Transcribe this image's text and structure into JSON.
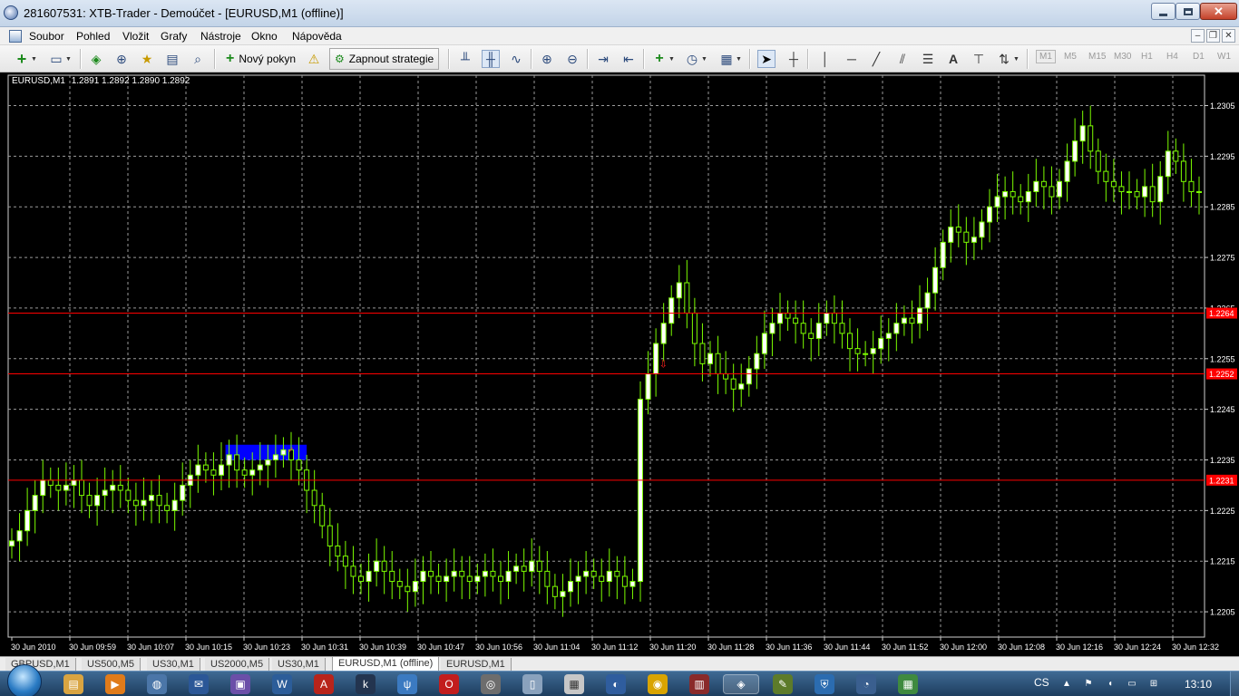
{
  "window": {
    "title": "281607531: XTB-Trader - Demoúčet - [EURUSD,M1 (offline)]",
    "close_glyph": "✕"
  },
  "menu": {
    "items": [
      "Soubor",
      "Pohled",
      "Vložit",
      "Grafy",
      "Nástroje",
      "Okno",
      "Nápověda"
    ]
  },
  "toolbar": {
    "new_order_label": "Nový pokyn",
    "strategy_label": "Zapnout strategie",
    "timeframes": [
      "M1",
      "M5",
      "M15",
      "M30",
      "H1",
      "H4",
      "D1",
      "W1"
    ],
    "active_timeframe": "M1"
  },
  "chart": {
    "info": {
      "symbol": "EURUSD,M1",
      "ohlc": "1.2891 1.2892 1.2890 1.2892"
    },
    "colors": {
      "background": "#000000",
      "grid": "#9a9a9a",
      "candle": "#7CFC00",
      "bull_body": "#ffffff",
      "hline": "#ff0000",
      "zone": "#0000ff"
    },
    "price_labels": [
      "1.2305",
      "1.2295",
      "1.2285",
      "1.2275",
      "1.2265",
      "1.2255",
      "1.2245",
      "1.2235",
      "1.2225",
      "1.2215",
      "1.2205"
    ],
    "time_labels": [
      "30 Jun 2010",
      "30 Jun 09:59",
      "30 Jun 10:07",
      "30 Jun 10:15",
      "30 Jun 10:23",
      "30 Jun 10:31",
      "30 Jun 10:39",
      "30 Jun 10:47",
      "30 Jun 10:56",
      "30 Jun 11:04",
      "30 Jun 11:12",
      "30 Jun 11:20",
      "30 Jun 11:28",
      "30 Jun 11:36",
      "30 Jun 11:44",
      "30 Jun 11:52",
      "30 Jun 12:00",
      "30 Jun 12:08",
      "30 Jun 12:16",
      "30 Jun 12:24",
      "30 Jun 12:32"
    ],
    "hlines": [
      {
        "price": 1.2264,
        "label": "1.2264"
      },
      {
        "price": 1.2252,
        "label": "1.2252"
      },
      {
        "price": 1.2231,
        "label": "1.2231"
      }
    ],
    "series": [
      1.2219,
      1.2221,
      1.2225,
      1.2228,
      1.2231,
      1.223,
      1.2229,
      1.223,
      1.2231,
      1.2228,
      1.2226,
      1.2228,
      1.2229,
      1.223,
      1.2229,
      1.2227,
      1.2226,
      1.2227,
      1.2228,
      1.2226,
      1.2225,
      1.2227,
      1.223,
      1.2232,
      1.2234,
      1.2233,
      1.2232,
      1.2234,
      1.2236,
      1.2233,
      1.2232,
      1.2233,
      1.2234,
      1.2235,
      1.2236,
      1.2237,
      1.2235,
      1.2233,
      1.2229,
      1.2226,
      1.2222,
      1.2218,
      1.2216,
      1.2214,
      1.2212,
      1.2211,
      1.2213,
      1.2215,
      1.2213,
      1.2211,
      1.221,
      1.2209,
      1.2211,
      1.2213,
      1.2212,
      1.2211,
      1.2212,
      1.2213,
      1.2212,
      1.2211,
      1.2212,
      1.2213,
      1.2212,
      1.2211,
      1.2213,
      1.2214,
      1.2213,
      1.2215,
      1.2213,
      1.221,
      1.2208,
      1.2209,
      1.2211,
      1.2212,
      1.2213,
      1.2212,
      1.2211,
      1.2213,
      1.2212,
      1.221,
      1.2211,
      1.2247,
      1.2252,
      1.2258,
      1.2262,
      1.2267,
      1.227,
      1.2264,
      1.2258,
      1.2254,
      1.2256,
      1.2252,
      1.2251,
      1.2249,
      1.225,
      1.2253,
      1.2256,
      1.226,
      1.2262,
      1.2264,
      1.2263,
      1.2262,
      1.226,
      1.2259,
      1.2262,
      1.2264,
      1.2262,
      1.226,
      1.2257,
      1.2256,
      1.2256,
      1.2257,
      1.2259,
      1.226,
      1.2262,
      1.2263,
      1.2262,
      1.2265,
      1.2268,
      1.2273,
      1.2278,
      1.2281,
      1.228,
      1.2278,
      1.2279,
      1.2282,
      1.2285,
      1.2287,
      1.2288,
      1.2287,
      1.2286,
      1.2288,
      1.229,
      1.2289,
      1.2287,
      1.229,
      1.2294,
      1.2298,
      1.2301,
      1.2296,
      1.2292,
      1.229,
      1.2289,
      1.2288,
      1.2288,
      1.2287,
      1.2289,
      1.2286,
      1.2291,
      1.2296,
      1.2294,
      1.229,
      1.2288,
      1.2288
    ],
    "buy_arrow_index": 84,
    "sell_marker_index": 36,
    "zone": {
      "from_index": 28,
      "to_index": 38,
      "price_low": 1.2235,
      "price_high": 1.2238
    }
  },
  "tabs": {
    "items": [
      "GBPUSD,M1",
      "US500,M5",
      "US30,M1",
      "US2000,M5",
      "US30,M1",
      "EURUSD,M1 (offline)",
      "EURUSD,M1"
    ],
    "active_index": 5
  },
  "taskbar": {
    "language": "CS",
    "time": "13:10"
  }
}
